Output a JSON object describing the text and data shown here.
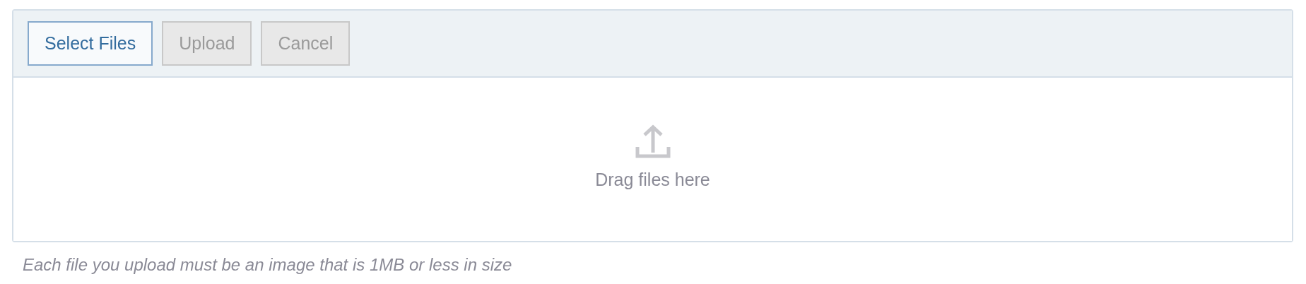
{
  "toolbar": {
    "buttons": [
      {
        "label": "Select Files",
        "disabled": false
      },
      {
        "label": "Upload",
        "disabled": true
      },
      {
        "label": "Cancel",
        "disabled": true
      }
    ]
  },
  "dropzone": {
    "label": "Drag files here"
  },
  "hint": "Each file you upload must be an image that is 1MB or less in size"
}
